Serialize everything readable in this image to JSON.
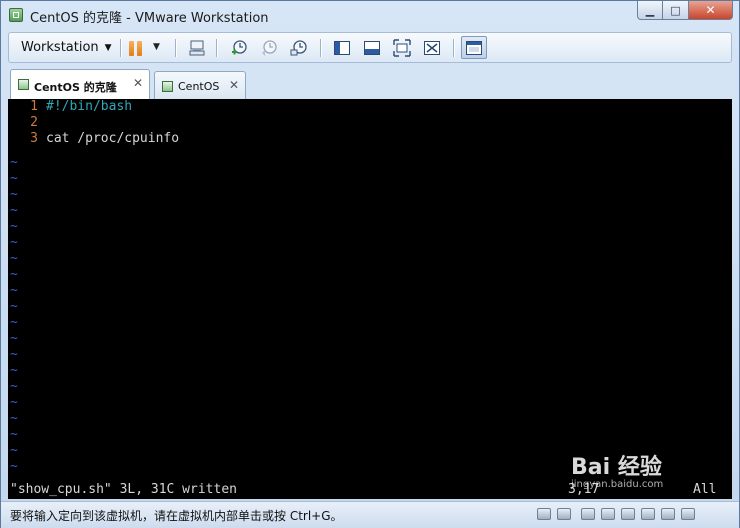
{
  "window": {
    "title": "CentOS 的克隆 - VMware Workstation",
    "minimize_glyph": "▁",
    "maximize_glyph": "□",
    "close_glyph": "✕"
  },
  "toolbar": {
    "workstation_label": "Workstation",
    "menu_caret": "▼",
    "icons": [
      "send-ctrl-alt-del-icon",
      "snapshot-take-icon",
      "snapshot-revert-icon",
      "snapshot-manager-icon",
      "console-view-icon",
      "quick-switch-icon",
      "fullscreen-icon",
      "unity-icon",
      "thumbnail-icon"
    ]
  },
  "tabs": [
    {
      "label": "CentOS 的克隆",
      "active": true,
      "close": "✕"
    },
    {
      "label": "CentOS",
      "active": false,
      "close": "✕"
    }
  ],
  "editor": {
    "lines": [
      {
        "num": "1",
        "text": "#!/bin/bash"
      },
      {
        "num": "2",
        "text": ""
      },
      {
        "num": "3",
        "text": "cat /proc/cpuinfo"
      }
    ],
    "tilde": "~",
    "status_message": "\"show_cpu.sh\" 3L, 31C written",
    "cursor_position": "3,17",
    "scroll_position": "All"
  },
  "watermark": {
    "text": "Bai 经验",
    "sub": "jingyan.baidu.com"
  },
  "statusbar": {
    "message": "要将输入定向到该虚拟机，请在虚拟机内部单击或按 Ctrl+G。"
  },
  "colors": {
    "line_number": "#d27a3c",
    "shebang": "#2fa8b8",
    "tilde": "#3d5bd6",
    "terminal_bg": "#000000"
  }
}
